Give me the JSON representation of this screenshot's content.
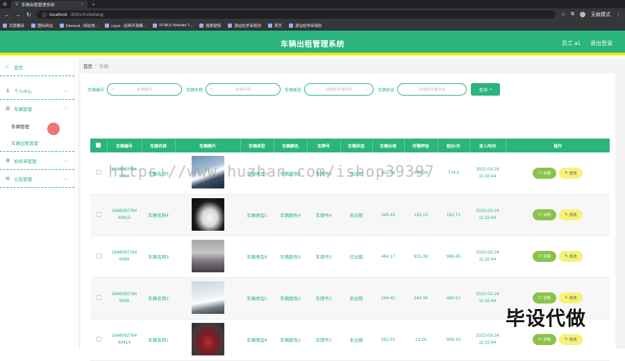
{
  "browser": {
    "tab_title": "车辆出租管理系统",
    "tab_plus": "+",
    "address_host": "localhost",
    "address_rest": ":8081/#/cheliang",
    "profile_label": "无痕模式",
    "bookmarks": [
      "百度翻译",
      "图标网站",
      "Element - 网站快...",
      "Layui - 经典开源模...",
      "HTML5 Website T...",
      "搜索壁纸",
      "源站检举审规则",
      "首页",
      "源站检举审规则"
    ]
  },
  "header": {
    "title": "车辆出租管理系统",
    "user_label": "员工 a1",
    "logout_label": "退出登录"
  },
  "sidebar": {
    "home": "首页",
    "personal": "个人中心",
    "vehicle": "车辆管理",
    "vehicle_sub1": "车辆管理",
    "vehicle_sub2": "车辆出租管理",
    "fix": "检修单管理",
    "notice": "公告管理"
  },
  "breadcrumb": {
    "home": "首页",
    "sep": "/",
    "current": "车辆"
  },
  "filters": {
    "code_label": "车辆编号",
    "code_placeholder": "车辆编号",
    "name_label": "车辆名称",
    "name_placeholder": "车辆名称",
    "type_label": "车辆类型",
    "type_placeholder": "请选择车辆类型",
    "status_label": "车辆状态",
    "status_placeholder": "请选择车辆状态",
    "query_label": "查询"
  },
  "watermark": "https://www.huzhan.com/ishop39397",
  "table": {
    "headers": [
      "车辆编号",
      "车辆名称",
      "车辆图片",
      "车辆类型",
      "车辆颜色",
      "车牌号",
      "车辆状态",
      "车辆价格",
      "所需押金",
      "租价/天",
      "录入时间",
      "操作"
    ],
    "rows": [
      {
        "code1": "1648092764",
        "code2": "6068",
        "name": "车辆名称5",
        "type": "车辆类型1",
        "color": "车辆颜色5",
        "plate": "车牌号5",
        "status": "已出租",
        "price": "815.08",
        "deposit": "999.28",
        "rent": "774.5",
        "date": "2022-03-24",
        "time": "11:32:44"
      },
      {
        "code1": "1648092764",
        "code2": "60615",
        "name": "车辆名称4",
        "type": "车辆类型1",
        "color": "车辆颜色4",
        "plate": "车牌号4",
        "status": "未出租",
        "price": "345.43",
        "deposit": "133.19",
        "rent": "162.71",
        "date": "2022-03-24",
        "time": "11:32:44"
      },
      {
        "code1": "1648092764",
        "code2": "6069",
        "name": "车辆名称3",
        "type": "车辆类型4",
        "color": "车辆颜色3",
        "plate": "车牌号3",
        "status": "已出租",
        "price": "464.17",
        "deposit": "915.36",
        "rent": "968.45",
        "date": "2022-03-24",
        "time": "11:32:44"
      },
      {
        "code1": "1648092764",
        "code2": "6056",
        "name": "车辆名称2",
        "type": "车辆类型1",
        "color": "车辆颜色2",
        "plate": "车牌号2",
        "status": "未出租",
        "price": "244.42",
        "deposit": "344.34",
        "rent": "484.51",
        "date": "2022-03-24",
        "time": "11:32:44"
      },
      {
        "code1": "1648092764",
        "code2": "60414",
        "name": "车辆名称1",
        "type": "车辆类型4",
        "color": "车辆颜色1",
        "plate": "车牌号1",
        "status": "未出租",
        "price": "592.01",
        "deposit": "13.26",
        "rent": "909.33",
        "date": "2022-03-24",
        "time": "11:32:44"
      }
    ],
    "detail_label": "详情",
    "edit_label": "修改"
  },
  "corner_text": "毕设代做"
}
